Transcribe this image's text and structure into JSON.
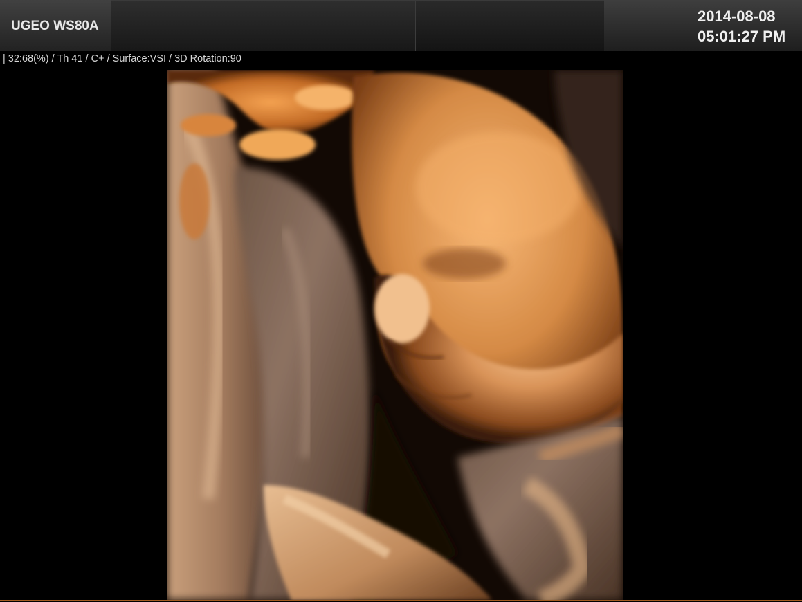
{
  "header": {
    "device_name": "UGEO WS80A",
    "date": "2014-08-08",
    "time": "05:01:27 PM"
  },
  "info_bar": {
    "parameters": "| 32:68(%) / Th 41 / C+ / Surface:VSI / 3D Rotation:90"
  },
  "colors": {
    "accent_line": "#a25c22",
    "header_gradient_top": "#3a3a3a",
    "header_gradient_bottom": "#1a1a1a",
    "render_highlight": "#f2a253",
    "render_midtone": "#b86a30",
    "render_shadow": "#2a1408"
  }
}
